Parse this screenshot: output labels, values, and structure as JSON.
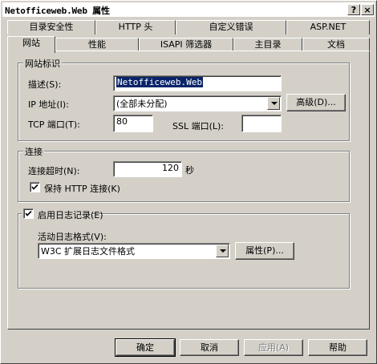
{
  "window": {
    "title": "Netofficeweb.Web 属性",
    "help_glyph": "?",
    "close_glyph": "×"
  },
  "tabs_row1": [
    "目录安全性",
    "HTTP 头",
    "自定义错误",
    "ASP.NET"
  ],
  "tabs_row2": [
    "网站",
    "性能",
    "ISAPI 筛选器",
    "主目录",
    "文档"
  ],
  "active_tab": "网站",
  "site_id": {
    "legend": "网站标识",
    "desc_label": "描述(S):",
    "desc_value": "Netofficeweb.Web",
    "ip_label": "IP 地址(I):",
    "ip_value": "(全部未分配)",
    "advanced_button": "高级(D)...",
    "tcp_label": "TCP 端口(T):",
    "tcp_value": "80",
    "ssl_label": "SSL 端口(L):",
    "ssl_value": ""
  },
  "connection": {
    "legend": "连接",
    "timeout_label": "连接超时(N):",
    "timeout_value": "120",
    "timeout_unit": "秒",
    "keepalive_label": "保持 HTTP 连接(K)",
    "keepalive_checked": true
  },
  "logging": {
    "enable_label": "启用日志记录(E)",
    "enable_checked": true,
    "format_label": "活动日志格式(V):",
    "format_value": "W3C 扩展日志文件格式",
    "properties_button": "属性(P)..."
  },
  "footer": {
    "ok": "确定",
    "cancel": "取消",
    "apply": "应用(A)",
    "help": "帮助"
  }
}
